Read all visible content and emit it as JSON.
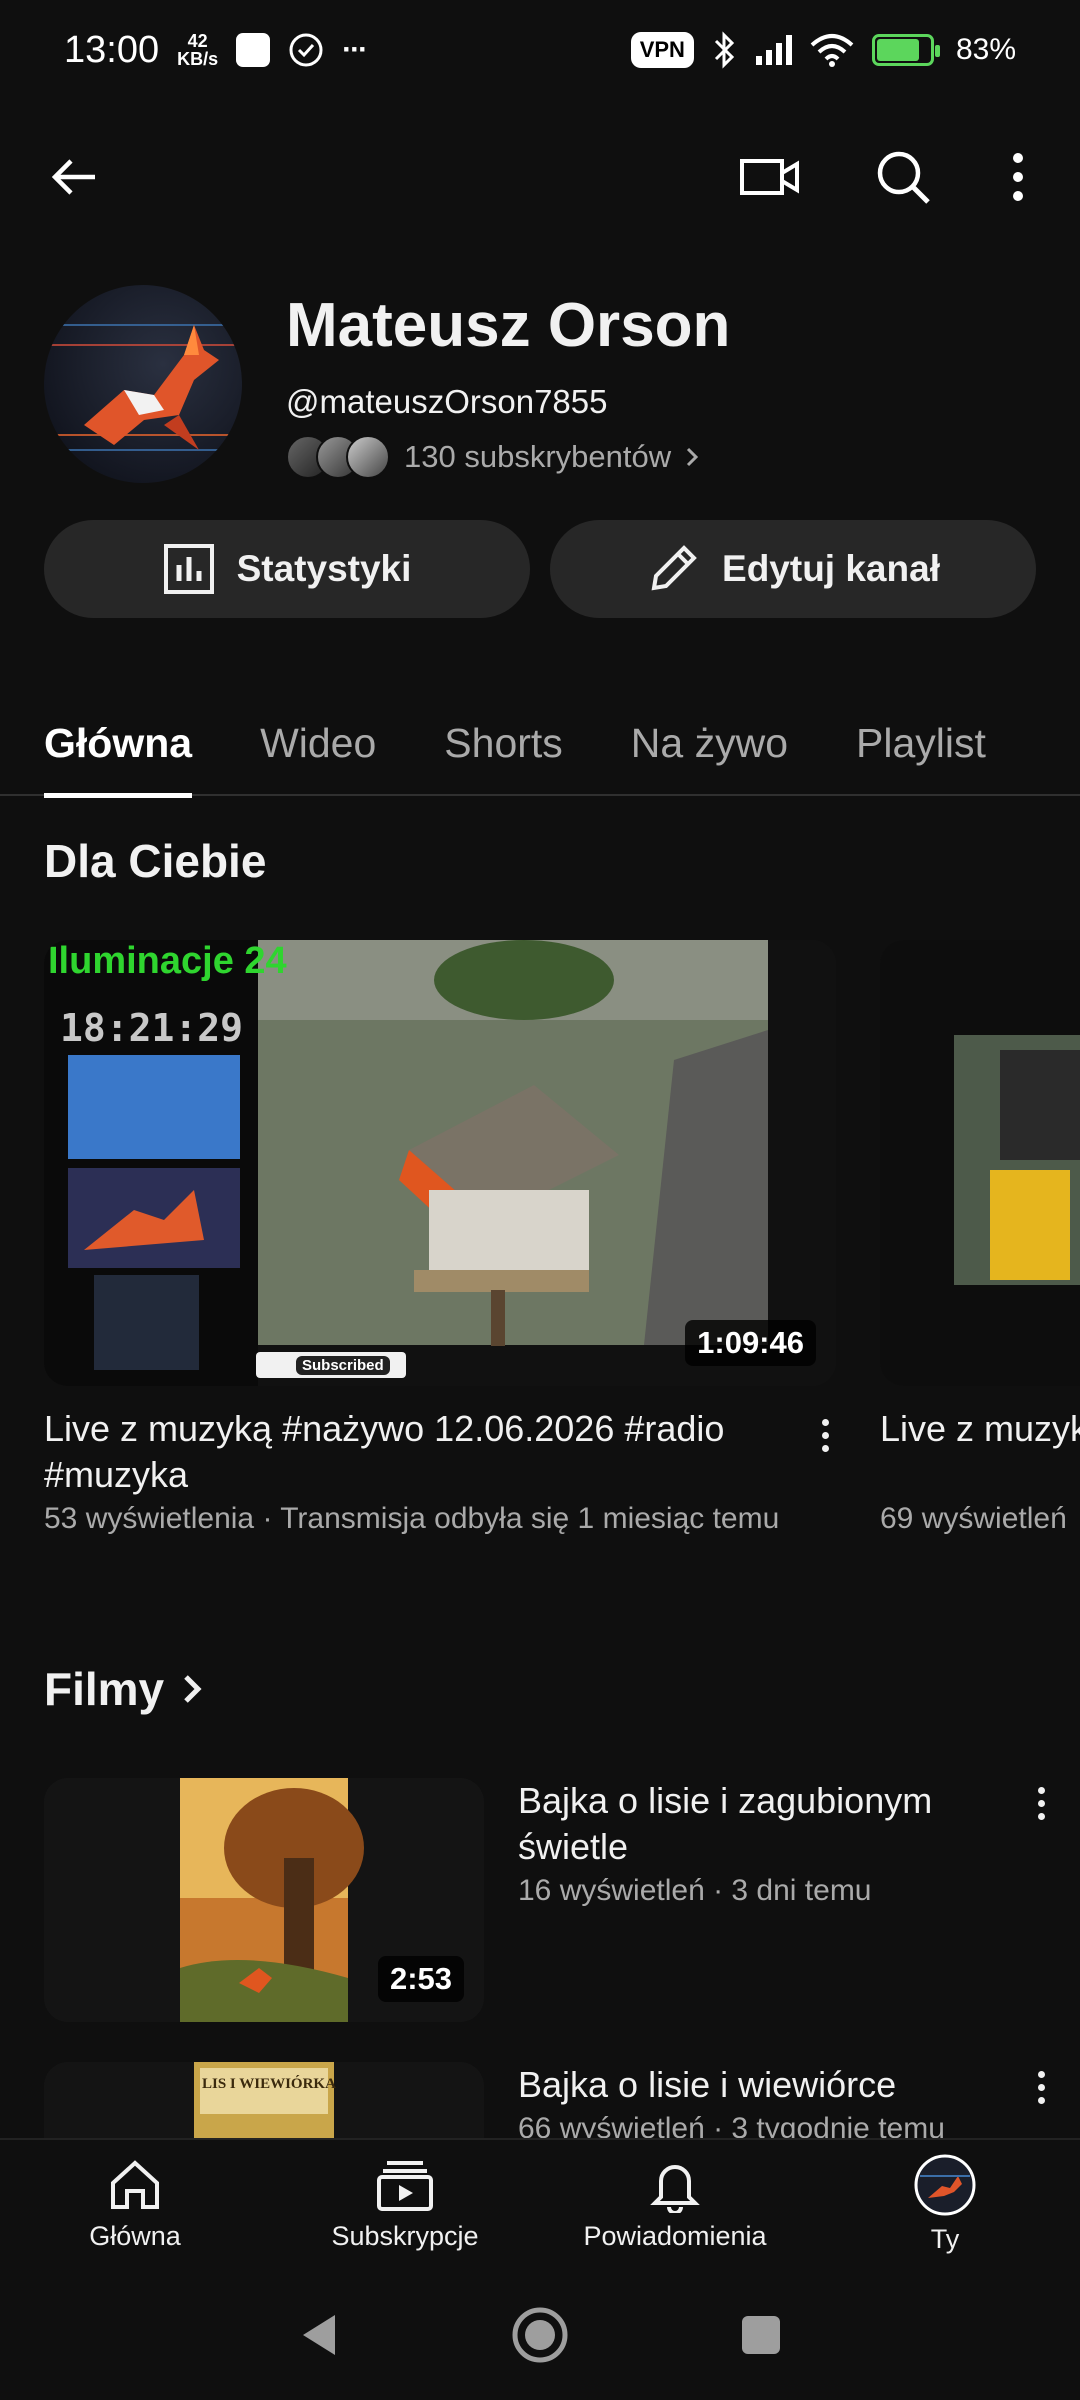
{
  "status_bar": {
    "time": "13:00",
    "net_speed_value": "42",
    "net_speed_unit": "KB/s",
    "more": "···",
    "vpn": "VPN",
    "battery_percent": "83%"
  },
  "channel": {
    "name": "Mateusz Orson",
    "handle": "@mateuszOrson7855",
    "subscribers": "130 subskrybentów"
  },
  "actions": {
    "stats_label": "Statystyki",
    "edit_label": "Edytuj kanał"
  },
  "tabs": [
    {
      "label": "Główna"
    },
    {
      "label": "Wideo"
    },
    {
      "label": "Shorts"
    },
    {
      "label": "Na żywo"
    },
    {
      "label": "Playlist"
    }
  ],
  "for_you": {
    "title": "Dla Ciebie",
    "cards": [
      {
        "title": "Live z muzyką #nażywo 12.06.2026 #radio #muzyka",
        "meta": "53 wyświetlenia · Transmisja odbyła się 1 miesiąc temu",
        "duration": "1:09:46",
        "thumb_text_brand": "Iluminacje 24",
        "thumb_text_clock": "18:21:29",
        "thumb_text_subscribed": "Subscribed"
      },
      {
        "title": "Live z muzyką #nażywo #radio #muzyka",
        "meta": "69 wyświetleń"
      }
    ]
  },
  "films": {
    "title": "Filmy",
    "items": [
      {
        "title": "Bajka o lisie i zagubionym świetle",
        "meta": "16 wyświetleń · 3 dni temu",
        "duration": "2:53"
      },
      {
        "title": "Bajka o lisie i wiewiórce",
        "meta": "66 wyświetleń · 3 tygodnie temu",
        "thumb_text": "LIS I WIEWIÓRKA"
      }
    ]
  },
  "bottom_nav": [
    {
      "label": "Główna",
      "icon": "home-icon"
    },
    {
      "label": "Subskrypcje",
      "icon": "subscriptions-icon"
    },
    {
      "label": "Powiadomienia",
      "icon": "bell-icon"
    },
    {
      "label": "Ty",
      "icon": "profile-avatar"
    }
  ],
  "colors": {
    "background": "#0f0f0f",
    "button_bg": "#272727",
    "secondary_text": "#aaaaaa",
    "battery": "#5cd65c"
  }
}
